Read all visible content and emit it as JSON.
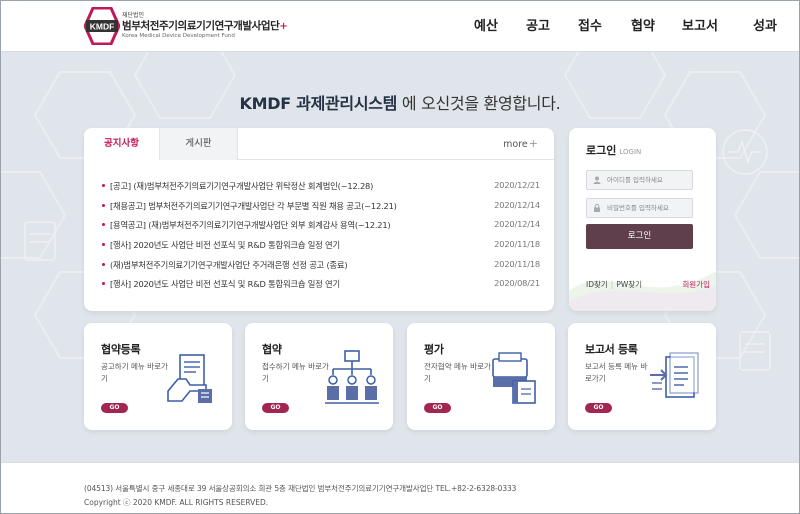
{
  "header": {
    "logo": {
      "mark": "KMDF",
      "subtitle": "재단법인",
      "name_kr": "범부처전주기의료기기연구개발사업단",
      "plus": "+",
      "name_en": "Korea Medical Device Development Fund"
    },
    "nav": [
      {
        "label": "예산"
      },
      {
        "label": "공고"
      },
      {
        "label": "접수"
      },
      {
        "label": "협약"
      },
      {
        "label": "보고서"
      },
      {
        "label": "성과"
      }
    ]
  },
  "welcome": {
    "brand": "KMDF 과제관리시스템",
    "message": " 에 오신것을 환영합니다."
  },
  "notice_panel": {
    "tabs": [
      {
        "label": "공지사항",
        "active": true
      },
      {
        "label": "게시판",
        "active": false
      }
    ],
    "more_label": "more",
    "more_icon": "+",
    "items": [
      {
        "title": "[공고] (재)범부처전주기의료기기연구개발사업단 위탁정산 회계법인(~12.28)",
        "date": "2020/12/21"
      },
      {
        "title": "[채용공고] 범부처전주기의료기기연구개발사업단 각 부문별 직원 채용 공고(~12.21)",
        "date": "2020/12/14"
      },
      {
        "title": "[용역공고] (재)범부처전주기의료기기연구개발사업단 외부 회계감사 용역(~12.21)",
        "date": "2020/12/14"
      },
      {
        "title": "[행사] 2020년도 사업단 비전 선포식 및 R&D 통합워크숍 일정 연기",
        "date": "2020/11/18"
      },
      {
        "title": "(재)범부처전주기의료기기연구개발사업단 주거래은행 선정 공고 (종료)",
        "date": "2020/11/18"
      },
      {
        "title": "[행사] 2020년도 사업단 비전 선포식 및 R&D 통합워크숍 일정 연기",
        "date": "2020/08/21"
      }
    ],
    "accent_color": "#c2185b"
  },
  "login": {
    "title": "로그인",
    "subtitle": "LOGIN",
    "id_placeholder": "아이디를 입력하세요",
    "pw_placeholder": "비밀번호를 입력하세요",
    "button": "로그인",
    "find_id": "ID찾기",
    "separator": "|",
    "find_pw": "PW찾기",
    "join": "회원가입",
    "button_color": "#5e3f4b"
  },
  "cards": [
    {
      "title": "협약등록",
      "desc": "공고하기 메뉴 바로가기",
      "go": "GO",
      "icon": "document-hand-icon"
    },
    {
      "title": "협약",
      "desc": "접수하기 메뉴 바로가기",
      "go": "GO",
      "icon": "org-chart-icon"
    },
    {
      "title": "평가",
      "desc": "전자협약 메뉴 바로가기",
      "go": "GO",
      "icon": "printer-book-icon"
    },
    {
      "title": "보고서 등록",
      "desc": "보고서 등록 메뉴 바로가기",
      "go": "GO",
      "icon": "document-arrow-icon"
    }
  ],
  "footer": {
    "address": "(04513) 서울특별시 중구 세종대로 39 서울상공회의소 회관 5층 재단법인 범부처전주기의료기기연구개발사업단   TEL.+82-2-6328-0333",
    "copyright": "Copyright ⓒ 2020 KMDF. ALL RIGHTS RESERVED."
  },
  "colors": {
    "brand_pink": "#c2185b",
    "go_badge": "#a32651",
    "navy": "#263246",
    "illustration_blue": "#3d5fa8"
  }
}
